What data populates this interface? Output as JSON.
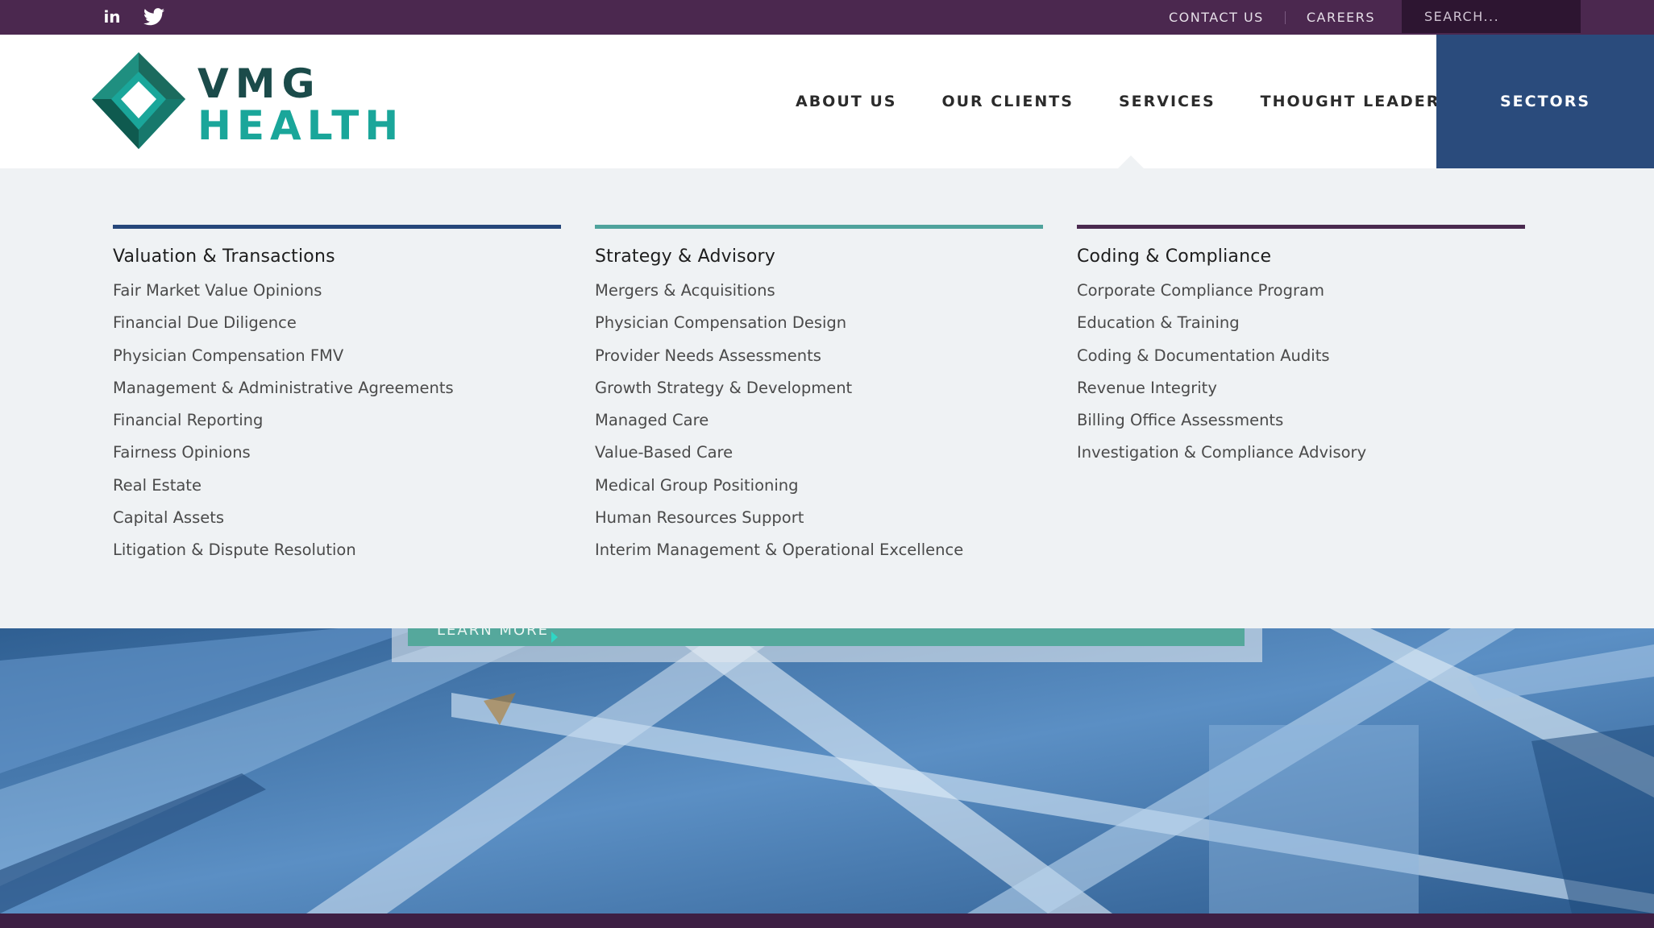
{
  "topbar": {
    "social": [
      {
        "icon": "linkedin-icon",
        "glyph": "in"
      },
      {
        "icon": "twitter-icon"
      }
    ],
    "links": [
      "CONTACT US",
      "CAREERS"
    ],
    "search_placeholder": "SEARCH..."
  },
  "logo": {
    "line1": "VMG",
    "line2": "HEALTH"
  },
  "nav": {
    "items": [
      "ABOUT US",
      "OUR CLIENTS",
      "SERVICES",
      "THOUGHT LEADERSHIP"
    ],
    "sectors": "SECTORS",
    "active": "SERVICES"
  },
  "menu": {
    "columns": [
      {
        "title": "Valuation & Transactions",
        "accent": "#26477a",
        "items": [
          "Fair Market Value Opinions",
          "Financial Due Diligence",
          "Physician Compensation FMV",
          "Management & Administrative Agreements",
          "Financial Reporting",
          "Fairness Opinions",
          "Real Estate",
          "Capital Assets",
          "Litigation & Dispute Resolution"
        ]
      },
      {
        "title": "Strategy & Advisory",
        "accent": "#4fa39c",
        "items": [
          "Mergers & Acquisitions",
          "Physician Compensation Design",
          "Provider Needs Assessments",
          "Growth Strategy & Development",
          "Managed Care",
          "Value-Based Care",
          "Medical Group Positioning",
          "Human Resources Support",
          "Interim Management & Operational Excellence"
        ]
      },
      {
        "title": "Coding & Compliance",
        "accent": "#4a2a4f",
        "items": [
          "Corporate Compliance Program",
          "Education & Training",
          "Coding & Documentation Audits",
          "Revenue Integrity",
          "Billing Office Assessments",
          "Investigation & Compliance Advisory"
        ]
      }
    ]
  },
  "hero": {
    "cta_label": "LEARN MORE"
  },
  "colors": {
    "topbar": "#4b284f",
    "sectors": "#2a4b7c",
    "teal": "#1aa69a",
    "panel": "#eff2f4"
  }
}
